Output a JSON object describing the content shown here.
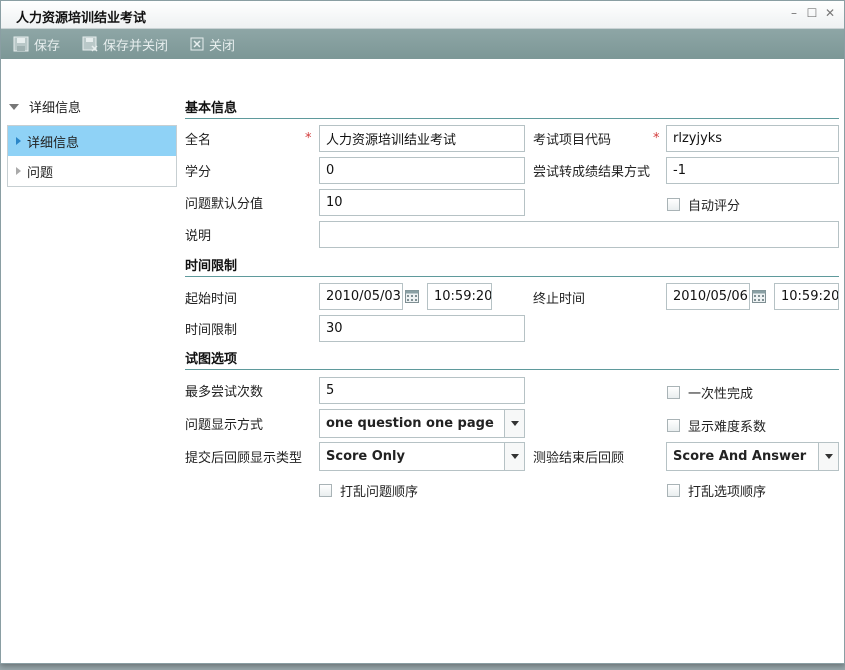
{
  "window": {
    "title": "人力资源培训结业考试"
  },
  "window_controls": {
    "minimize": "–",
    "maximize": "☐",
    "close": "✕"
  },
  "toolbar": {
    "save": "保存",
    "save_close": "保存并关闭",
    "close": "关闭"
  },
  "nav": {
    "header": "详细信息",
    "items": [
      {
        "label": "详细信息",
        "active": true
      },
      {
        "label": "问题",
        "active": false
      }
    ]
  },
  "basic": {
    "title": "基本信息",
    "full_name_label": "全名",
    "full_name_value": "人力资源培训结业考试",
    "code_label": "考试项目代码",
    "code_value": "rlzyjyks",
    "credit_label": "学分",
    "credit_value": "0",
    "convert_label": "尝试转成绩结果方式",
    "convert_value": "-1",
    "default_score_label": "问题默认分值",
    "default_score_value": "10",
    "auto_grade_label": "自动评分",
    "desc_label": "说明",
    "desc_value": "",
    "required_mark": "*"
  },
  "time": {
    "title": "时间限制",
    "start_label": "起始时间",
    "start_date": "2010/05/03",
    "start_time": "10:59:20",
    "end_label": "终止时间",
    "end_date": "2010/05/06",
    "end_time": "10:59:20",
    "limit_label": "时间限制",
    "limit_value": "30"
  },
  "attempt": {
    "title": "试图选项",
    "max_label": "最多尝试次数",
    "max_value": "5",
    "one_time_label": "一次性完成",
    "display_label": "问题显示方式",
    "display_value": "one question one page",
    "difficulty_label": "显示难度系数",
    "review_type_label": "提交后回顾显示类型",
    "review_type_value": "Score Only",
    "review_after_label": "测验结束后回顾",
    "review_after_value": "Score And Answer",
    "shuffle_q_label": "打乱问题顺序",
    "shuffle_opt_label": "打乱选项顺序"
  },
  "colors": {
    "toolbar": "#8ea6a6",
    "nav_active": "#8fd2f6",
    "section_rule": "#5f9a9c",
    "required": "#d23a3a"
  }
}
